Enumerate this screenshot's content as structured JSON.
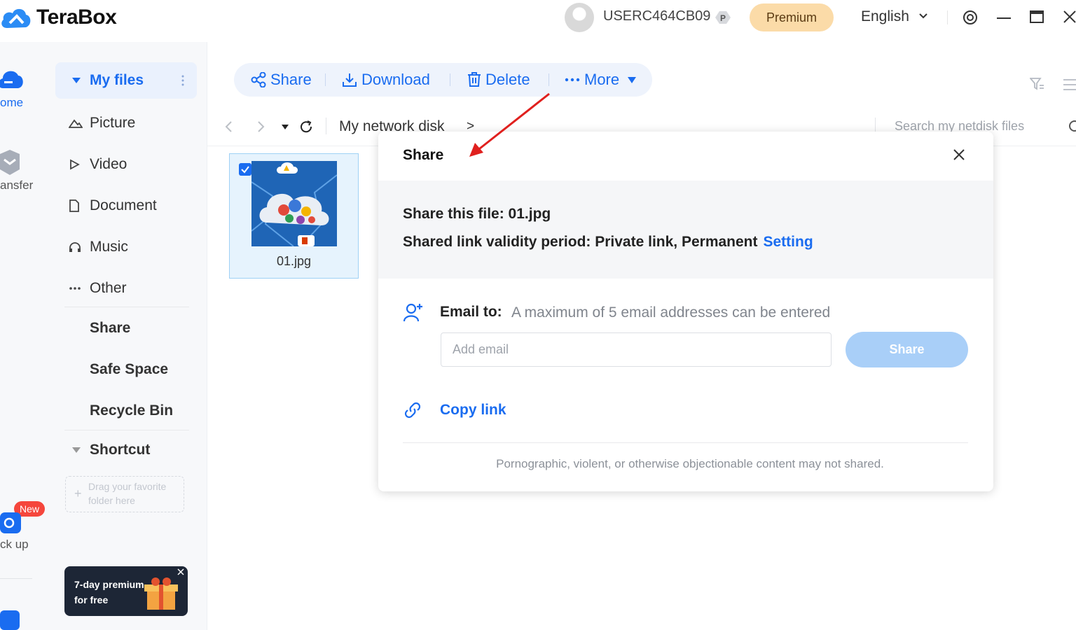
{
  "app": {
    "name": "TeraBox"
  },
  "header": {
    "username": "USERC464CB09",
    "premium_label": "Premium",
    "language": "English"
  },
  "rail": {
    "home_label": "ome",
    "transfer_label": "ansfer",
    "backup_label": "ck up",
    "new_badge": "New"
  },
  "sidebar": {
    "my_files": "My files",
    "categories": [
      "Picture",
      "Video",
      "Document",
      "Music",
      "Other"
    ],
    "share": "Share",
    "safe_space": "Safe Space",
    "recycle_bin": "Recycle Bin",
    "shortcut": "Shortcut",
    "dropzone_line1": "Drag your favorite",
    "dropzone_line2": "folder here",
    "promo_line1": "7-day premium",
    "promo_line2": "for free"
  },
  "toolbar": {
    "share": "Share",
    "download": "Download",
    "delete": "Delete",
    "more": "More"
  },
  "pathbar": {
    "path": "My network disk",
    "separator": ">",
    "search_placeholder": "Search my netdisk files"
  },
  "file": {
    "name": "01.jpg",
    "selected": true
  },
  "modal": {
    "title": "Share",
    "share_file": "Share this file: 01.jpg",
    "validity": "Shared link validity period: Private link, Permanent",
    "setting": "Setting",
    "email_label": "Email to:",
    "email_hint": "A maximum of 5 email addresses can be entered",
    "email_placeholder": "Add email",
    "share_button": "Share",
    "copy_link": "Copy link",
    "disclaimer": "Pornographic, violent, or otherwise objectionable content may not shared."
  },
  "colors": {
    "accent": "#1a6cf0",
    "premium": "#fbdba8",
    "annotation_arrow": "#e0201e"
  }
}
